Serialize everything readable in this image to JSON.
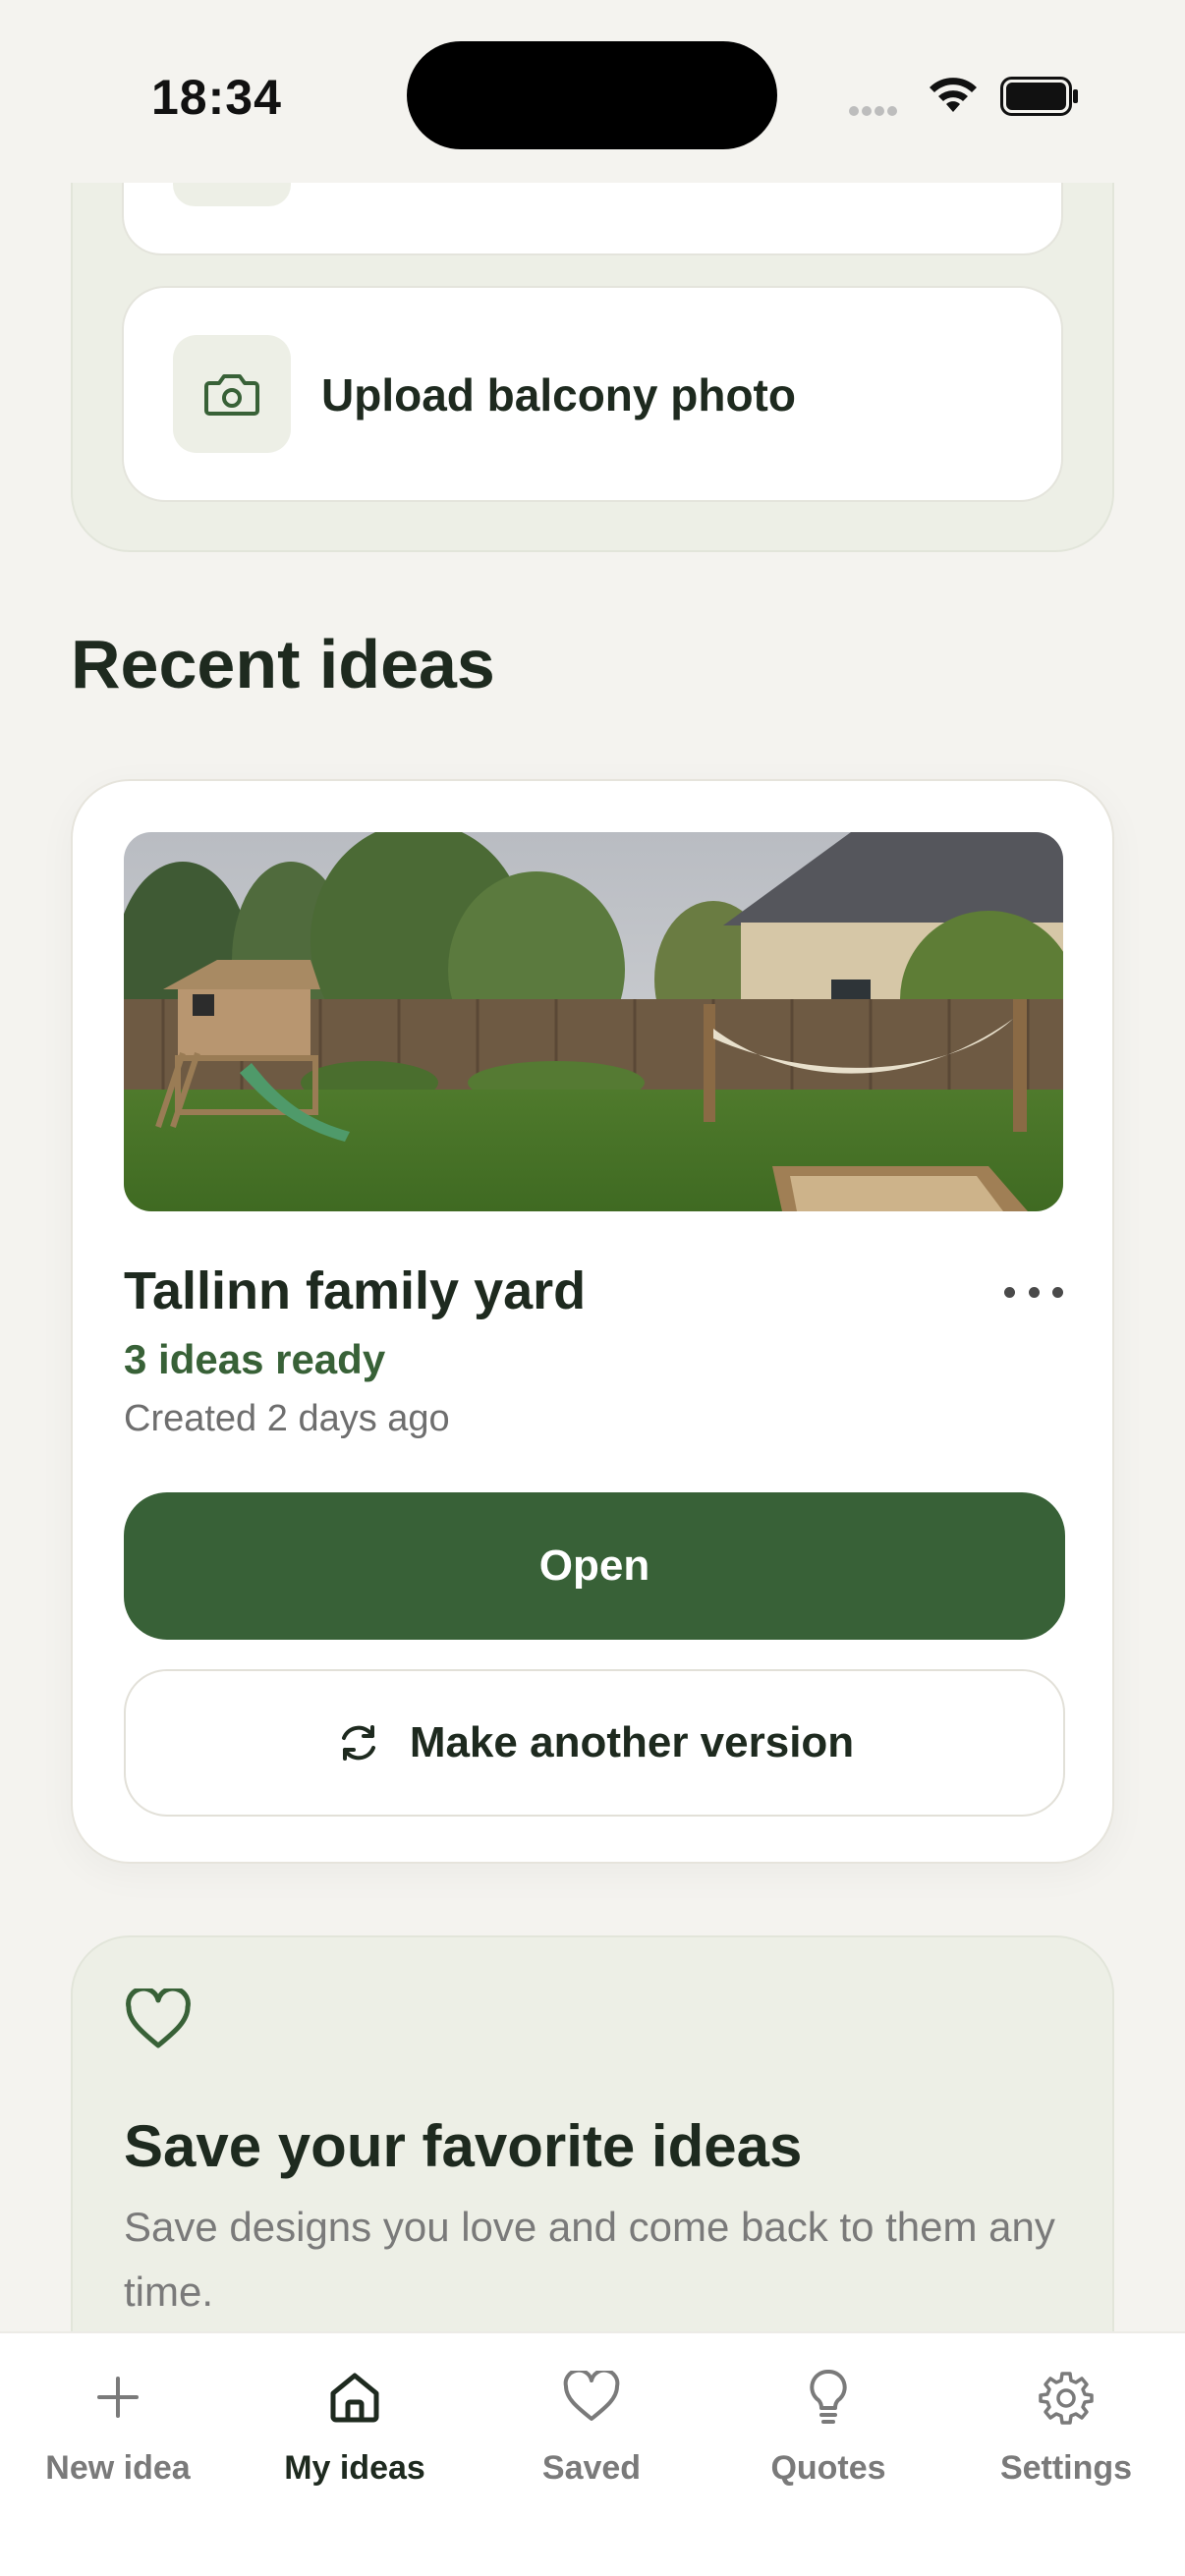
{
  "status_bar": {
    "time": "18:34"
  },
  "upload": {
    "label": "Upload balcony photo",
    "icon": "camera-icon"
  },
  "recent": {
    "title": "Recent ideas",
    "card": {
      "title": "Tallinn family yard",
      "status": "3 ideas ready",
      "created": "Created 2 days ago",
      "open_label": "Open",
      "version_label": "Make another version"
    }
  },
  "favorites": {
    "title": "Save your favorite ideas",
    "description": "Save designs you love and come back to them any time."
  },
  "tabs": [
    {
      "label": "New idea",
      "icon": "plus-icon"
    },
    {
      "label": "My ideas",
      "icon": "home-icon",
      "active": true
    },
    {
      "label": "Saved",
      "icon": "heart-icon"
    },
    {
      "label": "Quotes",
      "icon": "lightbulb-icon"
    },
    {
      "label": "Settings",
      "icon": "gear-icon"
    }
  ],
  "colors": {
    "accent": "#386137",
    "background": "#f4f3ef",
    "card_tint": "#edefe6"
  }
}
